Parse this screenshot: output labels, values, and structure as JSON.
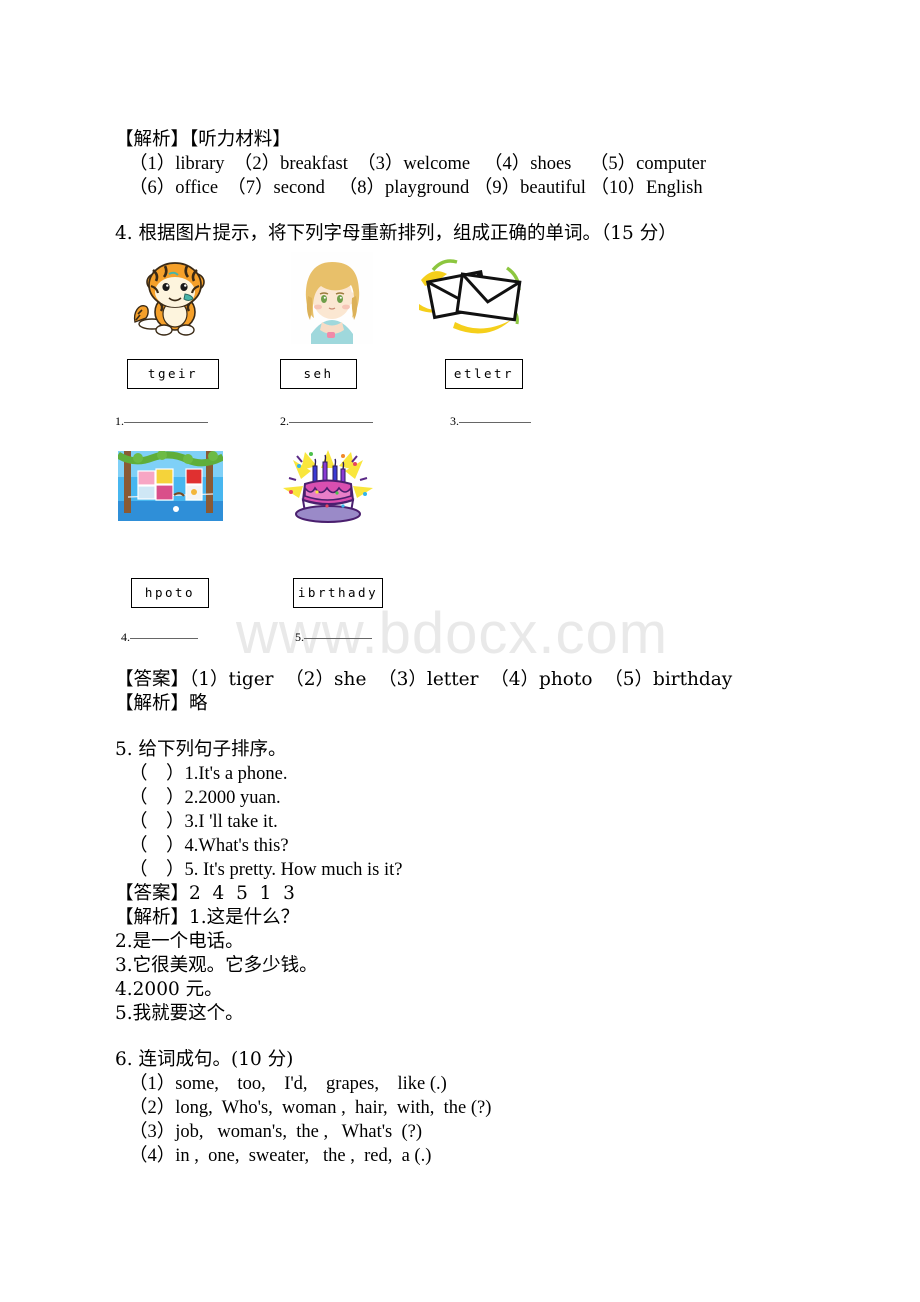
{
  "watermark": "www.bdocx.com",
  "listening": {
    "header": "【解析】【听力材料】",
    "row1": "（1）library  （2）breakfast  （3）welcome   （4）shoes    （5）computer",
    "row2": "（6）office  （7）second   （8）playground （9）beautiful （10）English"
  },
  "q4": {
    "prompt": "4. 根据图片提示，将下列字母重新排列，组成正确的单词。（15 分）",
    "images": [
      {
        "name": "tiger-image",
        "alt": "tiger"
      },
      {
        "name": "girl-image",
        "alt": "she"
      },
      {
        "name": "envelope-image",
        "alt": "letter"
      },
      {
        "name": "photos-image",
        "alt": "photo"
      },
      {
        "name": "cake-image",
        "alt": "birthday"
      }
    ],
    "boxes": [
      {
        "scrambled": "tgeir"
      },
      {
        "scrambled": "seh"
      },
      {
        "scrambled": "etletr"
      },
      {
        "scrambled": "hpoto"
      },
      {
        "scrambled": "ibrthady"
      }
    ],
    "blanks": [
      "1.",
      "2.",
      "3.",
      "4.",
      "5."
    ],
    "answer_line": "【答案】（1）tiger  （2）she  （3）letter  （4）photo  （5）birthday",
    "explain_line": "【解析】略"
  },
  "q5": {
    "prompt": "5. 给下列句子排序。",
    "items": [
      "（    ）1.It's a phone.",
      "（    ）2.2000 yuan.",
      "（    ）3.I 'll take it.",
      "（    ）4.What's this?",
      "（    ）5. It's pretty. How much is it?"
    ],
    "answer_line": "【答案】2  4  5  1  3",
    "explain_lines": [
      "【解析】1.这是什么？",
      "2.是一个电话。",
      "3.它很美观。它多少钱。",
      "4.2000 元。",
      "5.我就要这个。"
    ]
  },
  "q6": {
    "prompt": "6. 连词成句。(10 分)",
    "items": [
      "（1）some,    too,    I'd,    grapes,    like (.)",
      "（2）long,  Who's,  woman ,  hair,  with,  the (?)",
      "（3）job,   woman's,  the ,   What's  (?)",
      "（4）in ,  one,  sweater,   the ,  red,  a (.)"
    ]
  }
}
